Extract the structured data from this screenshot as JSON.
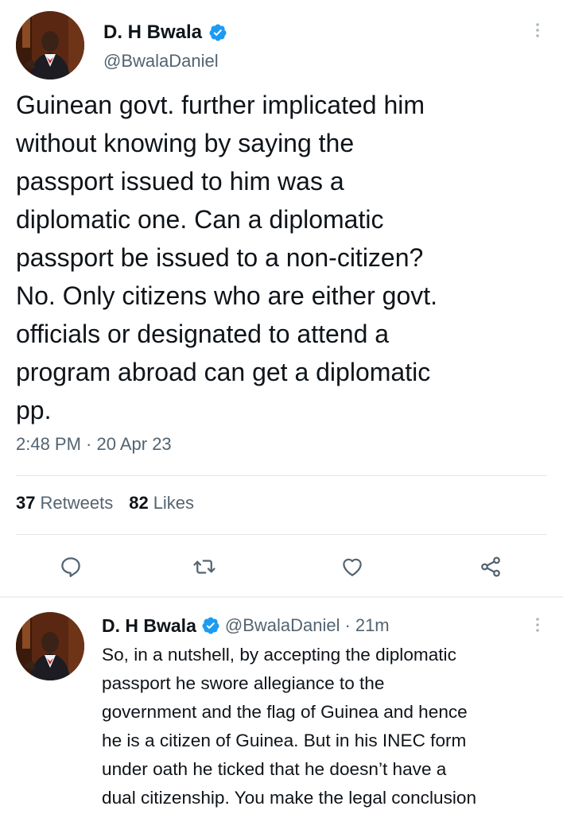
{
  "main_tweet": {
    "author_name": "D. H Bwala",
    "handle": "@BwalaDaniel",
    "verified": true,
    "text": "Guinean govt. further implicated him\nwithout knowing by saying the\npassport issued to him was a\ndiplomatic one. Can a diplomatic\npassport be issued to a non-citizen?\nNo. Only citizens who are either govt.\nofficials or designated to attend a\nprogram abroad can get a diplomatic\npp.",
    "timestamp": "2:48 PM · 20 Apr 23",
    "retweets_count": "37",
    "retweets_label": "Retweets",
    "likes_count": "82",
    "likes_label": "Likes"
  },
  "actions": {
    "reply_icon": "reply-icon",
    "retweet_icon": "retweet-icon",
    "like_icon": "heart-icon",
    "share_icon": "share-icon"
  },
  "reply_tweet": {
    "author_name": "D. H Bwala",
    "handle": "@BwalaDaniel",
    "separator": "·",
    "time": "21m",
    "lines": [
      "So, in a nutshell, by accepting the diplomatic",
      "passport he swore allegiance to the",
      "government and the flag of Guinea and hence",
      "he is a citizen of Guinea. But in his INEC form",
      "under oath he ticked that he doesn’t have a",
      "dual citizenship. You make the legal conclusion"
    ]
  },
  "colors": {
    "verified_blue": "#1d9bf0",
    "icon_gray": "#536471",
    "text_primary": "#0f1419",
    "text_secondary": "#536471"
  }
}
